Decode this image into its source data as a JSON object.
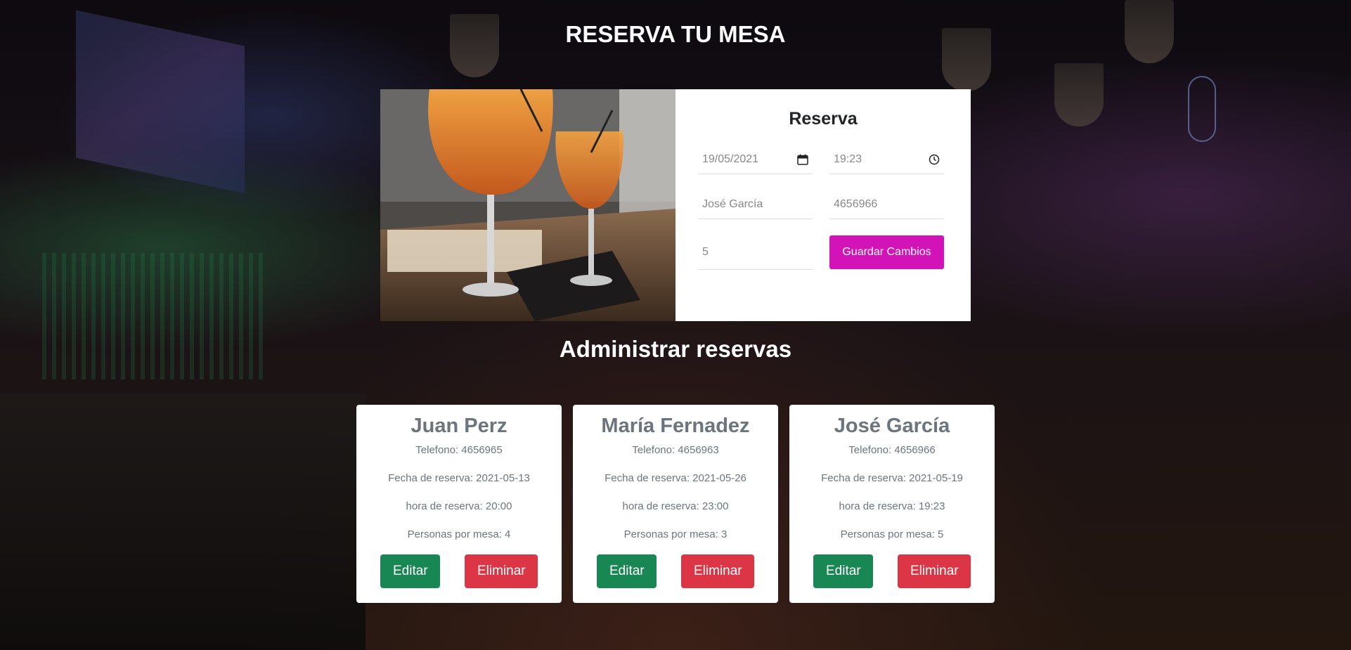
{
  "page": {
    "title": "RESERVA TU MESA",
    "admin_title": "Administrar reservas"
  },
  "form": {
    "title": "Reserva",
    "date": "19/05/2021",
    "time": "19:23",
    "name": "José García",
    "phone": "4656966",
    "people": "5",
    "save_label": "Guardar Cambios",
    "photo_alt": "cocktails on a bar table"
  },
  "reservations": [
    {
      "name": "Juan Perz",
      "phone": "Telefono: 4656965",
      "date": "Fecha de reserva: 2021-05-13",
      "time": "hora de reserva: 20:00",
      "people": "Personas por mesa: 4",
      "edit_label": "Editar",
      "delete_label": "Eliminar"
    },
    {
      "name": "María Fernadez",
      "phone": "Telefono: 4656963",
      "date": "Fecha de reserva: 2021-05-26",
      "time": "hora de reserva: 23:00",
      "people": "Personas por mesa: 3",
      "edit_label": "Editar",
      "delete_label": "Eliminar"
    },
    {
      "name": "José García",
      "phone": "Telefono: 4656966",
      "date": "Fecha de reserva: 2021-05-19",
      "time": "hora de reserva: 19:23",
      "people": "Personas por mesa: 5",
      "edit_label": "Editar",
      "delete_label": "Eliminar"
    }
  ],
  "colors": {
    "accent": "#d113b7",
    "edit": "#198754",
    "delete": "#dc3545",
    "card_text": "#6c757d"
  },
  "icons": {
    "date": "calendar-icon",
    "time": "clock-icon"
  }
}
